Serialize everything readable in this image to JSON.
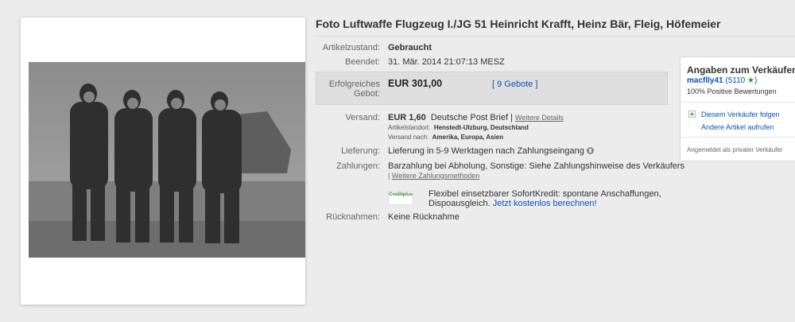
{
  "listing": {
    "title": "Foto Luftwaffe Flugzeug I./JG 51 Heinricht Krafft, Heinz Bär, Fleig, Höfemeier"
  },
  "details": {
    "condition": {
      "label": "Artikelzustand:",
      "value": "Gebraucht"
    },
    "ended": {
      "label": "Beendet:",
      "value": "31. Mär. 2014  21:07:13 MESZ"
    },
    "bid": {
      "label_line1": "Erfolgreiches",
      "label_line2": "Gebot:",
      "price": "EUR 301,00",
      "bids": "[ 9 Gebote ]"
    },
    "shipping": {
      "label": "Versand:",
      "price": "EUR 1,60",
      "method": "Deutsche Post Brief |",
      "details_link": "Weitere Details",
      "location_label": "Artikelstandort:",
      "location_value": "Henstedt-Ulzburg, Deutschland",
      "ships_to_label": "Versand nach:",
      "ships_to_value": "Amerika, Europa, Asien"
    },
    "delivery": {
      "label": "Lieferung:",
      "value": "Lieferung in 5-9 Werktagen nach Zahlungseingang"
    },
    "payment": {
      "label": "Zahlungen:",
      "value": "Barzahlung bei Abholung,  Sonstige: Siehe Zahlungshinweise des Verkäufers",
      "more_prefix": "|",
      "more_link": "Weitere Zahlungsmethoden"
    },
    "credit": {
      "logo_text": "Creditplus",
      "text_line1": "Flexibel einsetzbarer SofortKredit: spontane Anschaffungen,",
      "text_line2": "Dispoausgleich.",
      "link": "Jetzt kostenlos berechnen!"
    },
    "returns": {
      "label": "Rücknahmen:",
      "value": "Keine Rücknahme"
    }
  },
  "seller": {
    "title": "Angaben zum Verkäufer",
    "name": "macflly41",
    "feedback": "(5110",
    "feedback_close": ")",
    "positive": "100% Positive Bewertungen",
    "follow": "Diesem Verkäufer folgen",
    "other_items": "Andere Artikel aufrufen",
    "footer": "Angemeldet als privater Verkäufer"
  },
  "colors": {
    "link": "#0654ba",
    "star": "#2d9a2d",
    "bid_box": "#dfdfdf"
  }
}
